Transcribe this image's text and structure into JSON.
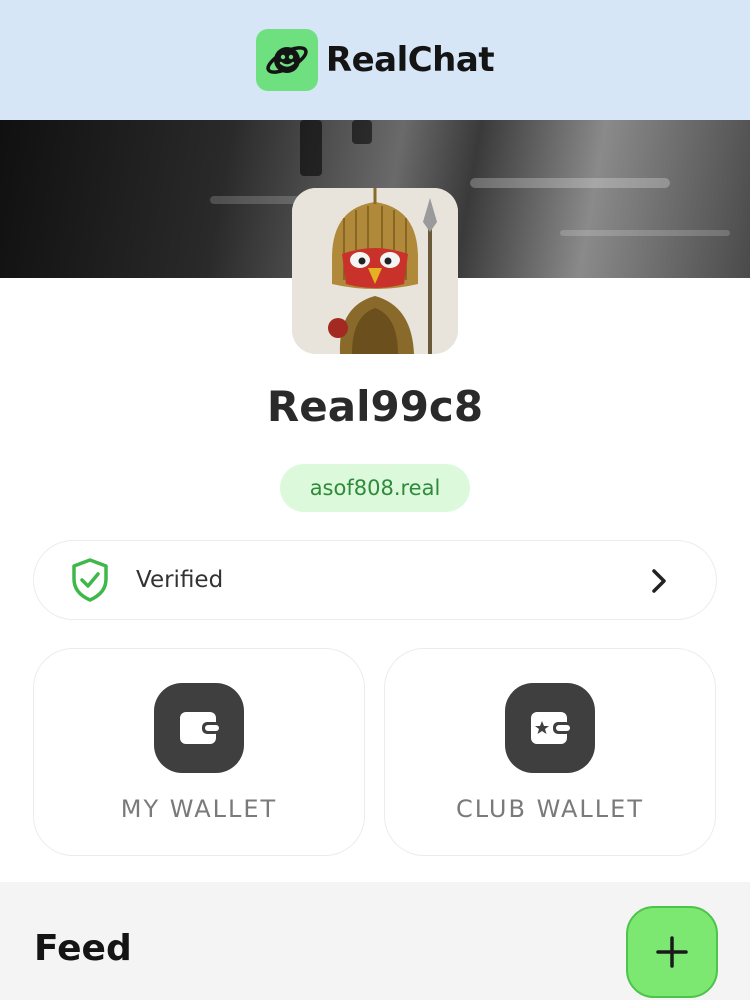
{
  "header": {
    "app_name": "RealChat",
    "logo_icon": "planet-smile-icon",
    "background_color": "#d6e6f6"
  },
  "profile": {
    "username": "Real99c8",
    "handle": "asof808.real",
    "avatar": "armored-bird-knight-avatar"
  },
  "verification": {
    "label": "Verified",
    "icon": "shield-check-icon",
    "accent_color": "#3fb84a"
  },
  "wallets": [
    {
      "label": "MY WALLET",
      "icon": "wallet-icon"
    },
    {
      "label": "CLUB WALLET",
      "icon": "wallet-star-icon"
    }
  ],
  "feed": {
    "title": "Feed",
    "add_icon": "plus-icon",
    "accent_color": "#7ce872"
  }
}
